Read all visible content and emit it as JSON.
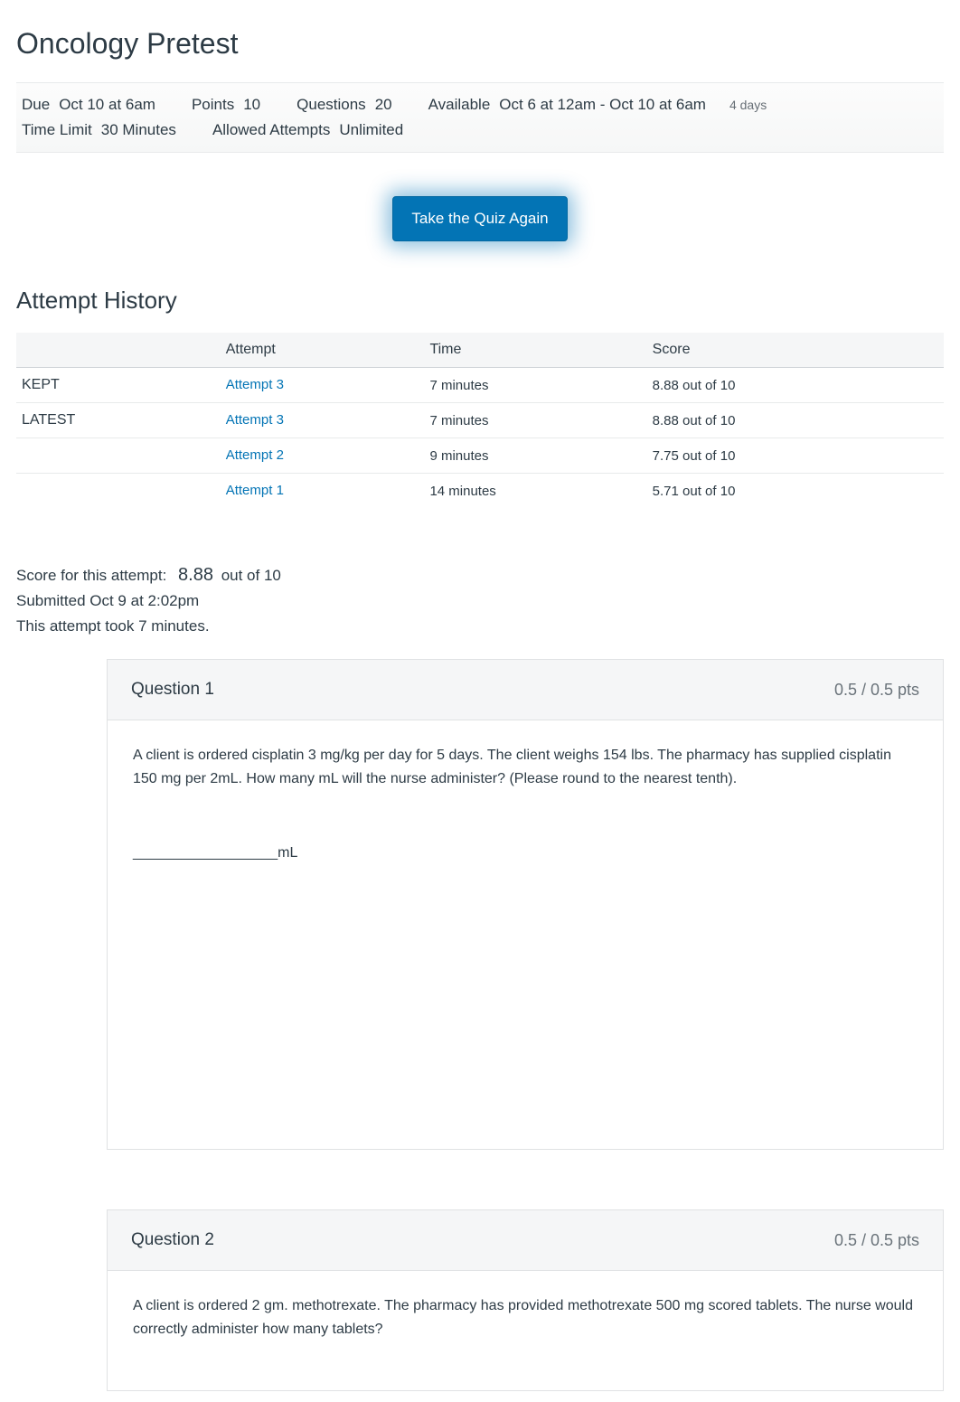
{
  "title": "Oncology Pretest",
  "meta": {
    "due_label": "Due",
    "due_value": "Oct 10 at 6am",
    "points_label": "Points",
    "points_value": "10",
    "questions_label": "Questions",
    "questions_value": "20",
    "available_label": "Available",
    "available_value": "Oct 6 at 12am - Oct 10 at 6am",
    "available_note": "4 days",
    "timelimit_label": "Time Limit",
    "timelimit_value": "30 Minutes",
    "attempts_label": "Allowed Attempts",
    "attempts_value": "Unlimited"
  },
  "take_again_label": "Take the Quiz Again",
  "history": {
    "heading": "Attempt History",
    "headers": {
      "attempt": "Attempt",
      "time": "Time",
      "score": "Score"
    },
    "rows": [
      {
        "tag": "KEPT",
        "attempt": "Attempt 3",
        "time": "7 minutes",
        "score": "8.88 out of 10"
      },
      {
        "tag": "LATEST",
        "attempt": "Attempt 3",
        "time": "7 minutes",
        "score": "8.88 out of 10"
      },
      {
        "tag": "",
        "attempt": "Attempt 2",
        "time": "9 minutes",
        "score": "7.75 out of 10"
      },
      {
        "tag": "",
        "attempt": "Attempt 1",
        "time": "14 minutes",
        "score": "5.71 out of 10"
      }
    ]
  },
  "summary": {
    "score_label": "Score for this attempt:",
    "score_value": "8.88",
    "score_suffix": "out of 10",
    "submitted": "Submitted Oct 9 at 2:02pm",
    "duration": "This attempt took 7 minutes."
  },
  "questions": [
    {
      "title": "Question 1",
      "pts": "0.5 / 0.5 pts",
      "body": "A client is ordered cisplatin 3 mg/kg per day for 5 days. The client weighs 154 lbs. The pharmacy has supplied cisplatin 150 mg per 2mL. How many mL will the nurse administer? (Please round to the nearest tenth).",
      "blank": "__________________mL"
    },
    {
      "title": "Question 2",
      "pts": "0.5 / 0.5 pts",
      "body": "A client is ordered 2 gm. methotrexate. The pharmacy has provided methotrexate 500 mg scored tablets. The nurse would correctly administer how many tablets?"
    }
  ]
}
